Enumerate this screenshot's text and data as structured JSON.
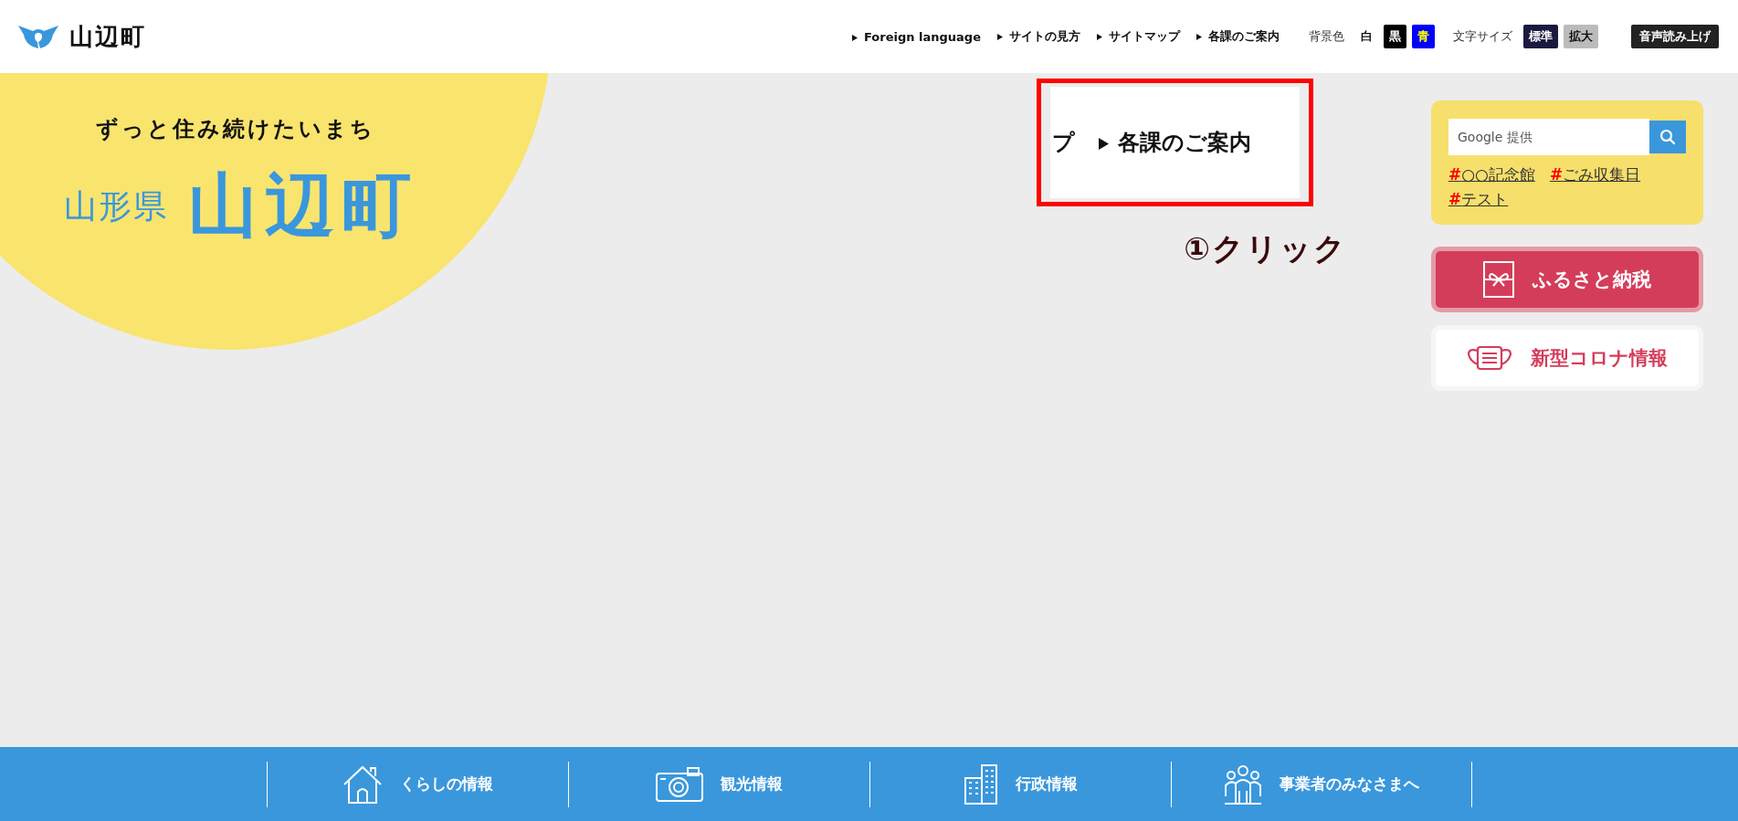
{
  "header": {
    "logo_text": "山辺町",
    "nav_links": [
      "Foreign language",
      "サイトの見方",
      "サイトマップ",
      "各課のご案内"
    ],
    "bg_color": {
      "label": "背景色",
      "options": [
        {
          "label": "白",
          "kind": "white"
        },
        {
          "label": "黒",
          "kind": "black"
        },
        {
          "label": "青",
          "kind": "blue"
        }
      ]
    },
    "text_size": {
      "label": "文字サイズ",
      "options": [
        {
          "label": "標準",
          "selected": true
        },
        {
          "label": "拡大",
          "selected": false
        }
      ]
    },
    "read_aloud": "音声読み上げ"
  },
  "hero": {
    "tagline": "ずっと住み続けたいまち",
    "prefecture": "山形県",
    "town": "山辺町"
  },
  "callout": {
    "cut_text": "プ",
    "link": "各課のご案内",
    "annotation": "①クリック"
  },
  "search": {
    "placeholder": "Google 提供",
    "tags": [
      {
        "mark": "#",
        "label": "○○記念館"
      },
      {
        "mark": "#",
        "label": "ごみ収集日"
      },
      {
        "mark": "#",
        "label": "テスト"
      }
    ]
  },
  "banners": [
    {
      "label": "ふるさと納税",
      "kind": "furusato"
    },
    {
      "label": "新型コロナ情報",
      "kind": "corona"
    }
  ],
  "footer_nav": [
    {
      "label": "くらしの情報",
      "kind": "house"
    },
    {
      "label": "観光情報",
      "kind": "camera"
    },
    {
      "label": "行政情報",
      "kind": "building"
    },
    {
      "label": "事業者のみなさまへ",
      "kind": "people"
    }
  ]
}
